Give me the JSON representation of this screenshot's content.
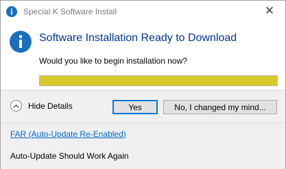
{
  "window": {
    "title": "Special K Software Install",
    "close_glyph": "✕"
  },
  "content": {
    "heading": "Software Installation Ready to Download",
    "question": "Would you like to begin installation now?",
    "progress": 1.0
  },
  "footer": {
    "details_label": "Hide Details",
    "yes_label": "Yes",
    "no_label": "No, I changed my mind..."
  },
  "details": {
    "link_text": "FAR (Auto-Update Re-Enabled)",
    "status_text": "Auto-Update Should Work Again"
  },
  "colors": {
    "heading": "#003399",
    "progress_fill": "#d7c82c",
    "info_icon": "#1a6fbd",
    "link": "#0066cc"
  }
}
